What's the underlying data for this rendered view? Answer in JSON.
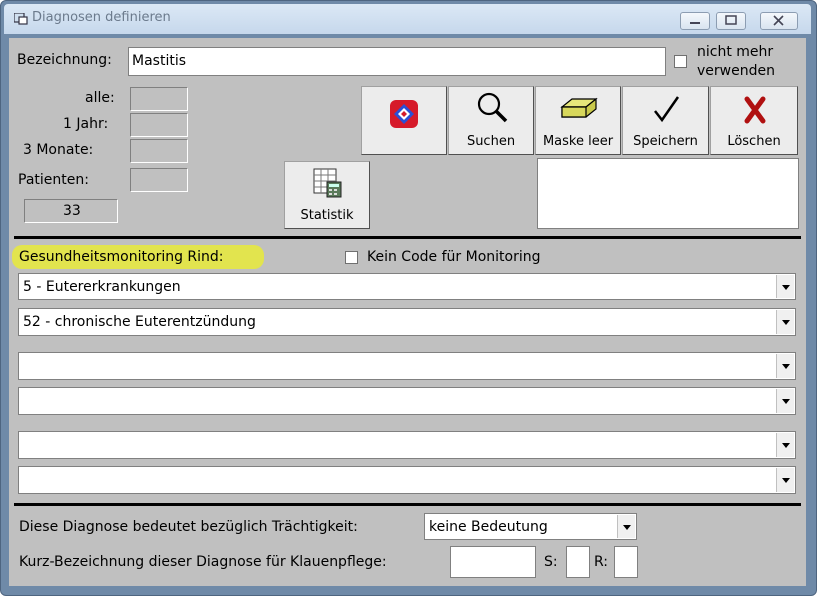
{
  "window": {
    "title": "Diagnosen definieren"
  },
  "form": {
    "bezeichnung_label": "Bezeichnung:",
    "bezeichnung_value": "Mastitis",
    "nicht_mehr_line1": "nicht mehr",
    "nicht_mehr_line2": "verwenden",
    "alle_label": "alle:",
    "jahr_label": "1 Jahr:",
    "monate_label": "3 Monate:",
    "patienten_label": "Patienten:",
    "count_value": "33"
  },
  "toolbar": {
    "suchen": "Suchen",
    "maske_leer": "Maske leer",
    "speichern": "Speichern",
    "loeschen": "Löschen",
    "statistik": "Statistik"
  },
  "monitoring": {
    "heading": "Gesundheitsmonitoring Rind:",
    "kein_code_label": "Kein Code für Monitoring",
    "combo1": "5 - Eutererkrankungen",
    "combo2": "52 - chronische Euterentzündung",
    "combo3": "",
    "combo4": "",
    "combo5": "",
    "combo6": ""
  },
  "footer": {
    "traechtigkeit_label": "Diese Diagnose bedeutet bezüglich Trächtigkeit:",
    "traechtigkeit_value": "keine Bedeutung",
    "kurz_label": "Kurz-Bezeichnung dieser Diagnose für Klauenpflege:",
    "s_label": "S:",
    "r_label": "R:"
  },
  "colors": {
    "highlight": "#e8ea3a",
    "titlebar": "#c6d8ec",
    "client": "#c0c0c0"
  }
}
